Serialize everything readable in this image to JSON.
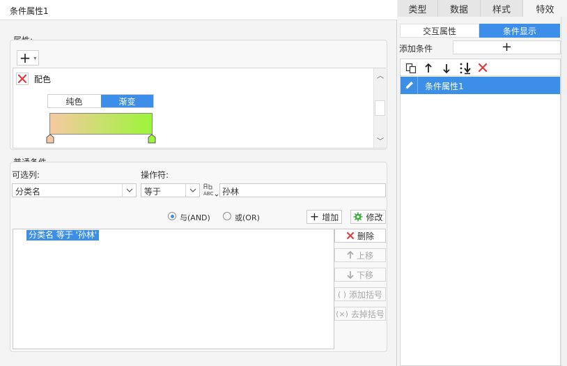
{
  "dialog": {
    "title": "条件属性1"
  },
  "attributes": {
    "group_label": "属性:",
    "add_symbol": "+",
    "item_label": "配色",
    "solid_label": "纯色",
    "gradient_label": "渐变",
    "gradient_start_color": "#f7c9a2",
    "gradient_end_color": "#9cf53a"
  },
  "conditions": {
    "group_label": "普通条件",
    "column_label": "可选列:",
    "column_value": "分类名",
    "operator_label": "操作符:",
    "operator_value": "等于",
    "value_input": "孙林",
    "and_label": "与(AND)",
    "or_label": "或(OR)",
    "and_selected": true,
    "add_button": "增加",
    "modify_button": "修改",
    "delete_button": "删除",
    "move_up_button": "上移",
    "move_down_button": "下移",
    "add_bracket_button": "添加括号",
    "remove_bracket_button": "去掉括号",
    "condition_items": [
      "分类名 等于 '孙林'"
    ]
  },
  "side_panel": {
    "tabs": [
      "类型",
      "数据",
      "样式",
      "特效"
    ],
    "active_tab": "特效",
    "sub_tabs": [
      "交互属性",
      "条件显示"
    ],
    "active_sub_tab": "条件显示",
    "add_condition_label": "添加条件",
    "add_symbol": "+",
    "list_items": [
      "条件属性1"
    ]
  },
  "colors": {
    "accent": "#3d8ee8",
    "selection": "#3b8fe6",
    "delete_red": "#e23a3a"
  }
}
